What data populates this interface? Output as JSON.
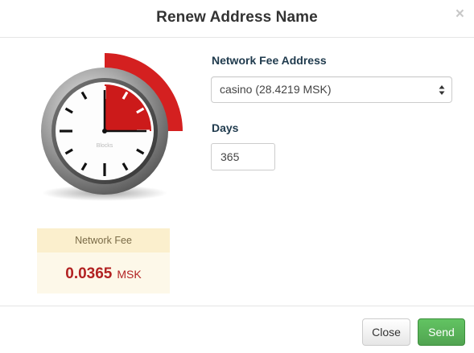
{
  "dialog": {
    "title": "Renew Address Name",
    "close_glyph": "×"
  },
  "clock": {
    "face_label": "Blocks",
    "accent_color": "#d42020"
  },
  "fee_box": {
    "header": "Network Fee",
    "amount": "0.0365",
    "unit": "MSK"
  },
  "form": {
    "fee_address_label": "Network Fee Address",
    "fee_address_value": "casino (28.4219 MSK)",
    "days_label": "Days",
    "days_value": "365"
  },
  "footer": {
    "close_label": "Close",
    "send_label": "Send"
  }
}
